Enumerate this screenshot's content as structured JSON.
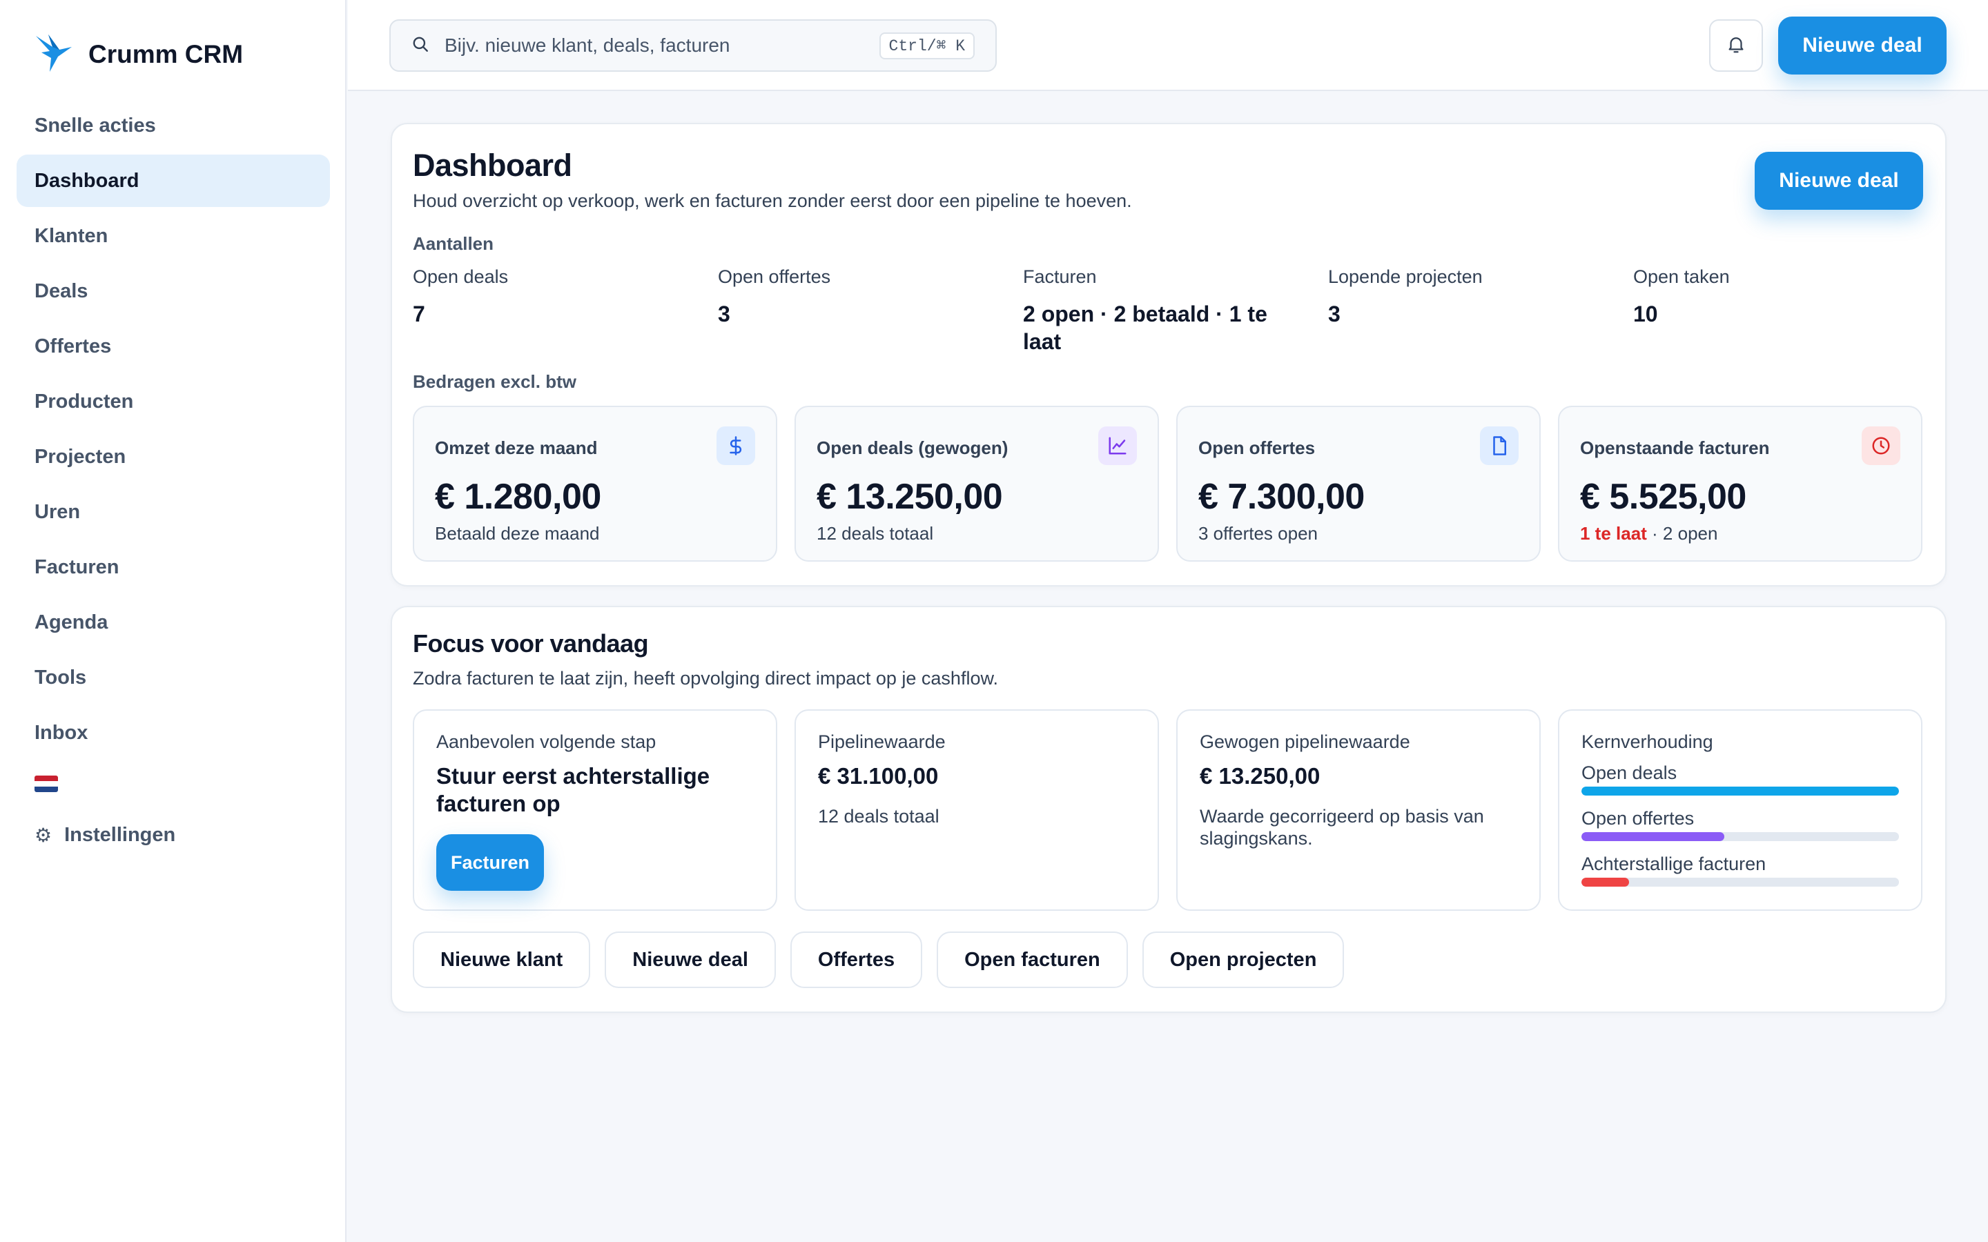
{
  "brand": {
    "name": "Crumm CRM",
    "logo_icon": "bird-logo-icon",
    "color": "#1a8fe3"
  },
  "sidebar": {
    "items": [
      {
        "label": "Snelle acties",
        "active": false
      },
      {
        "label": "Dashboard",
        "active": true
      },
      {
        "label": "Klanten",
        "active": false
      },
      {
        "label": "Deals",
        "active": false
      },
      {
        "label": "Offertes",
        "active": false
      },
      {
        "label": "Producten",
        "active": false
      },
      {
        "label": "Projecten",
        "active": false
      },
      {
        "label": "Uren",
        "active": false
      },
      {
        "label": "Facturen",
        "active": false
      },
      {
        "label": "Agenda",
        "active": false
      },
      {
        "label": "Tools",
        "active": false
      },
      {
        "label": "Inbox",
        "active": false
      }
    ],
    "language_flag": "nl-flag-icon",
    "settings_label": "Instellingen",
    "settings_icon": "⚙"
  },
  "topbar": {
    "search_placeholder": "Bijv. nieuwe klant, deals, facturen",
    "search_shortcut": "Ctrl/⌘ K",
    "bell_icon": "bell-icon",
    "new_deal_label": "Nieuwe deal"
  },
  "dashboard": {
    "title": "Dashboard",
    "subtitle": "Houd overzicht op verkoop, werk en facturen zonder eerst door een pipeline te hoeven.",
    "new_deal_label": "Nieuwe deal",
    "counts_label": "Aantallen",
    "counts": [
      {
        "label": "Open deals",
        "value": "7"
      },
      {
        "label": "Open offertes",
        "value": "3"
      },
      {
        "label": "Facturen",
        "value": "2 open · 2 betaald · 1 te laat"
      },
      {
        "label": "Lopende projecten",
        "value": "3"
      },
      {
        "label": "Open taken",
        "value": "10"
      }
    ],
    "amounts_label": "Bedragen excl. btw",
    "stats": [
      {
        "label": "Omzet deze maand",
        "value": "€ 1.280,00",
        "note": "Betaald deze maand",
        "icon": "dollar-icon",
        "icon_color": "#2563eb",
        "icon_bg": "#e0edff"
      },
      {
        "label": "Open deals (gewogen)",
        "value": "€ 13.250,00",
        "note": "12 deals totaal",
        "icon": "line-chart-icon",
        "icon_color": "#7c3aed",
        "icon_bg": "#ede7ff"
      },
      {
        "label": "Open offertes",
        "value": "€ 7.300,00",
        "note": "3 offertes open",
        "icon": "document-icon",
        "icon_color": "#2563eb",
        "icon_bg": "#e0edff"
      },
      {
        "label": "Openstaande facturen",
        "value": "€ 5.525,00",
        "note_late": "1 te laat",
        "note_rest": " · 2 open",
        "icon": "clock-icon",
        "icon_color": "#dc2626",
        "icon_bg": "#fde4e4"
      }
    ]
  },
  "focus": {
    "title": "Focus voor vandaag",
    "subtitle": "Zodra facturen te laat zijn, heeft opvolging direct impact op je cashflow.",
    "next_step": {
      "label": "Aanbevolen volgende stap",
      "value": "Stuur eerst achterstallige facturen op",
      "button": "Facturen"
    },
    "pipeline": {
      "label": "Pipelinewaarde",
      "value": "€ 31.100,00",
      "note": "12 deals totaal"
    },
    "weighted": {
      "label": "Gewogen pipelinewaarde",
      "value": "€ 13.250,00",
      "note": "Waarde gecorrigeerd op basis van slagingskans."
    },
    "ratio": {
      "label": "Kernverhouding",
      "bars": [
        {
          "label": "Open deals",
          "fraction": 1.0,
          "color": "#0ea5e9"
        },
        {
          "label": "Open offertes",
          "fraction": 0.45,
          "color": "#8b5cf6"
        },
        {
          "label": "Achterstallige facturen",
          "fraction": 0.15,
          "color": "#ef4444"
        }
      ]
    },
    "quick_actions": [
      "Nieuwe klant",
      "Nieuwe deal",
      "Offertes",
      "Open facturen",
      "Open projecten"
    ]
  }
}
